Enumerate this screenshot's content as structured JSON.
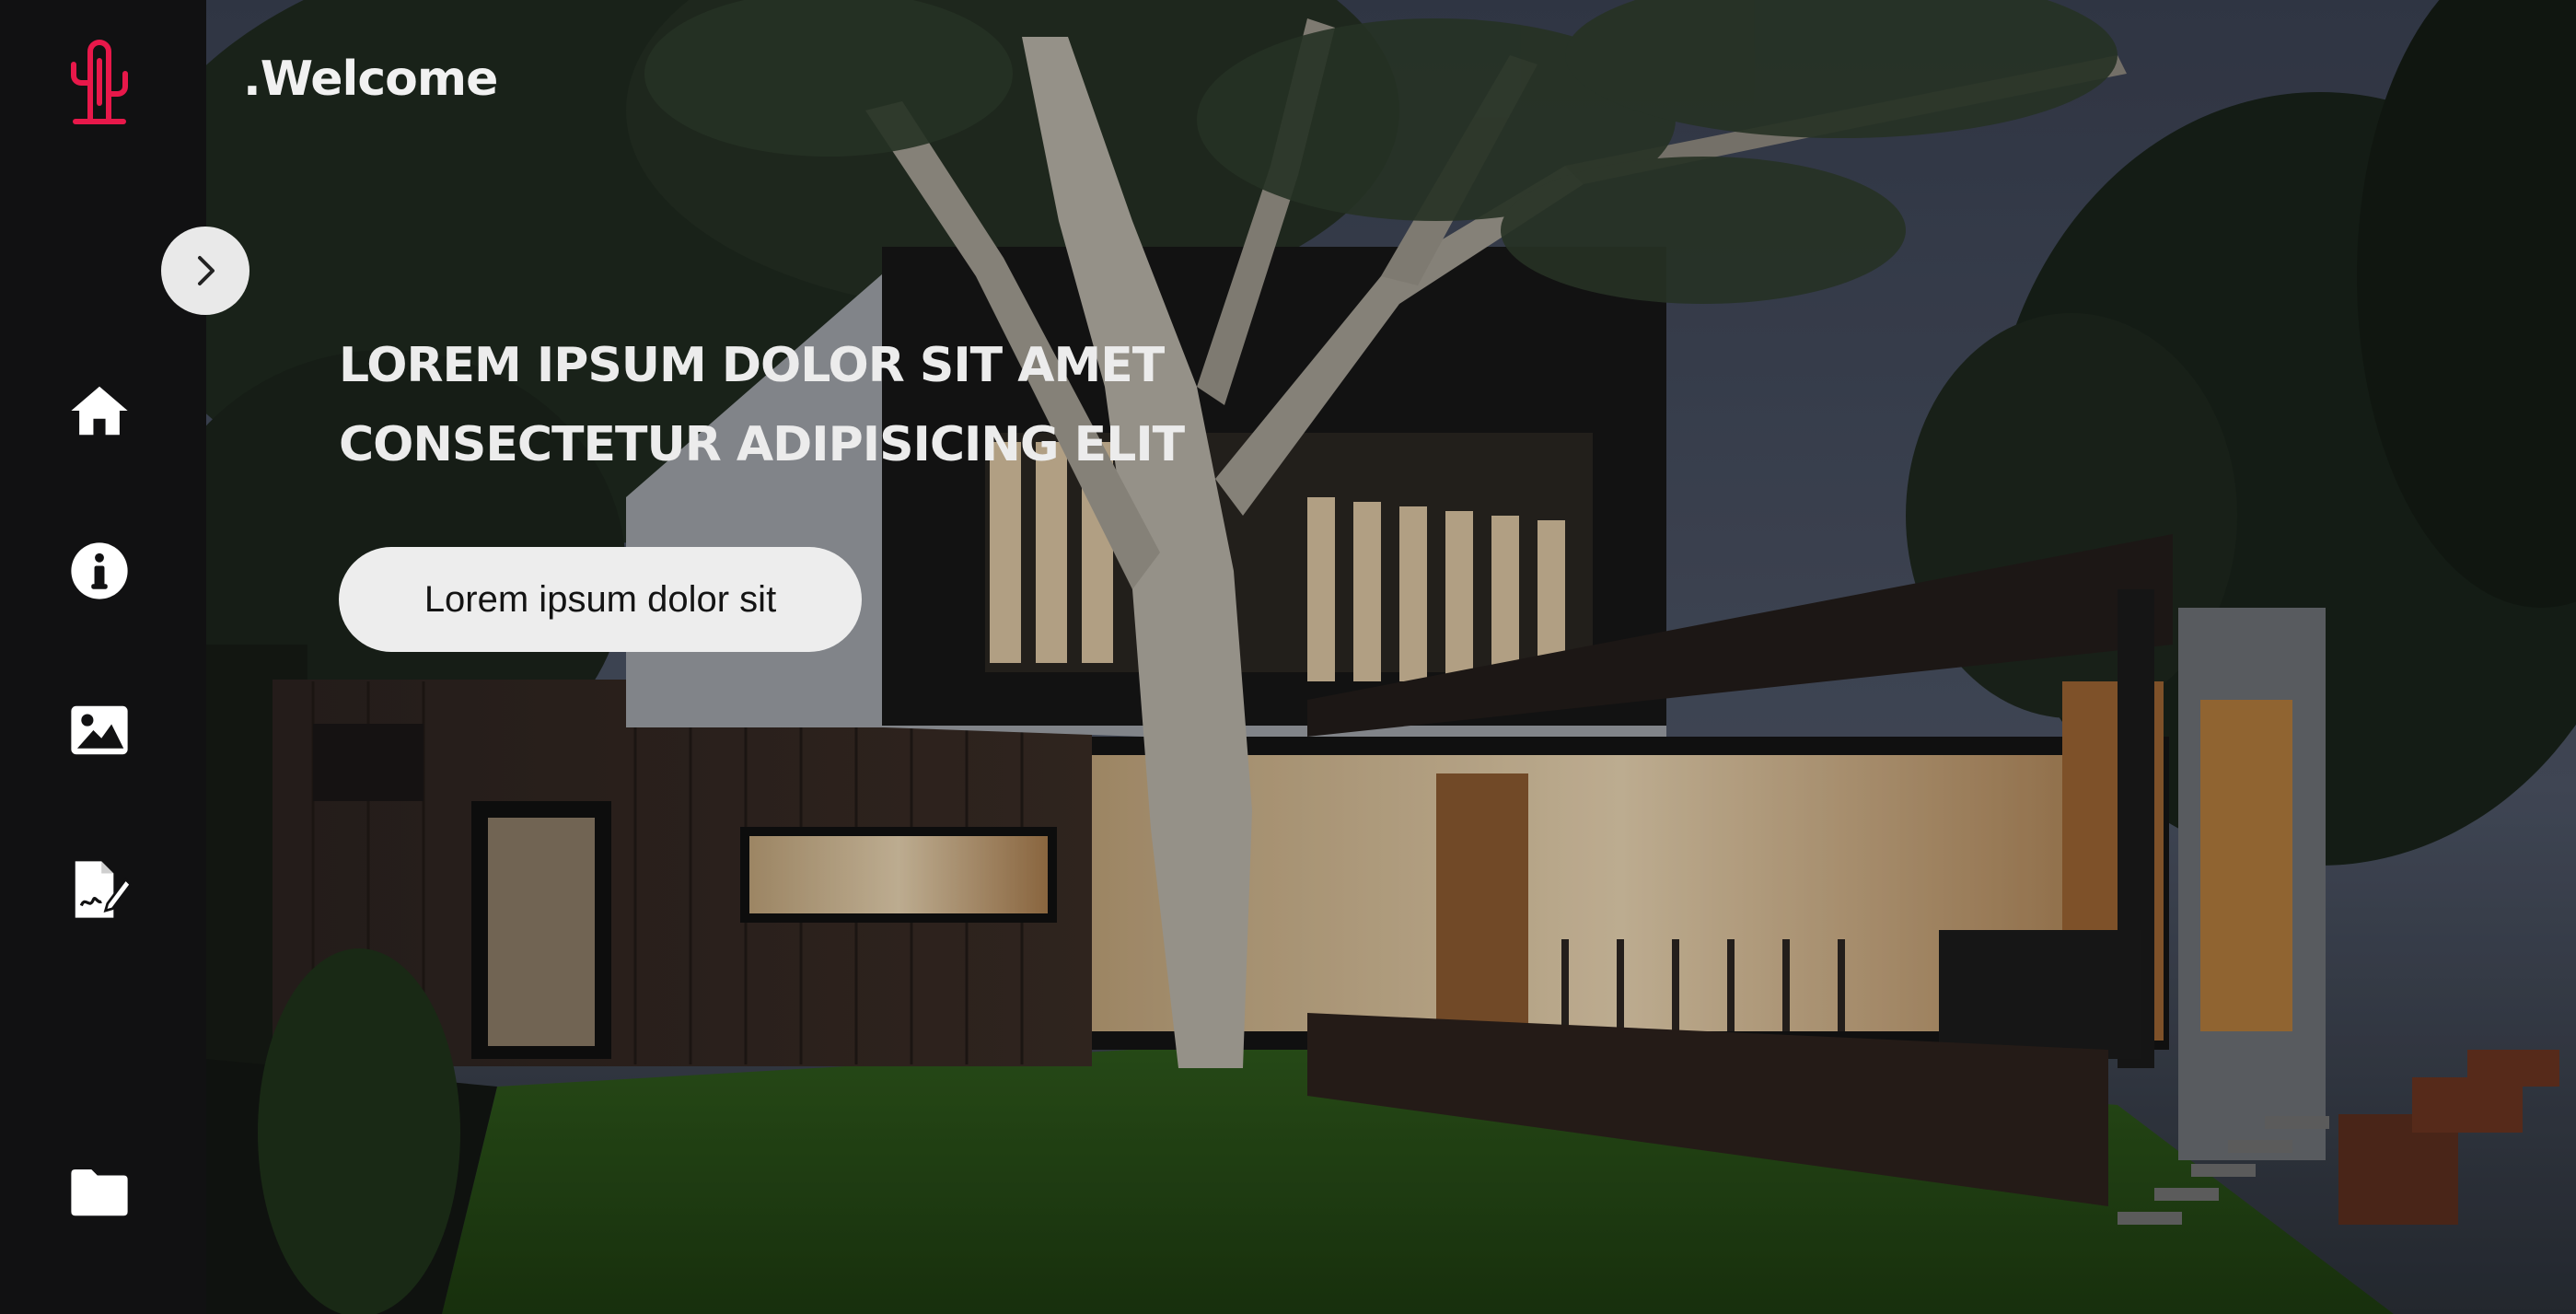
{
  "header": {
    "title": ".Welcome"
  },
  "hero": {
    "line1": "LOREM IPSUM DOLOR SIT AMET",
    "line2": "CONSECTETUR ADIPISICING ELIT",
    "button_label": "Lorem ipsum dolor sit"
  },
  "sidebar": {
    "logo_icon": "cactus-icon",
    "toggle_icon": "chevron-right-icon",
    "items": [
      {
        "icon": "home-icon"
      },
      {
        "icon": "info-icon"
      },
      {
        "icon": "image-icon"
      },
      {
        "icon": "signature-document-icon"
      },
      {
        "icon": "folder-icon"
      }
    ]
  },
  "colors": {
    "sidebar_bg": "#111112",
    "logo_accent": "#e8184a",
    "button_bg": "#ededed",
    "text": "#f1f1f1"
  }
}
